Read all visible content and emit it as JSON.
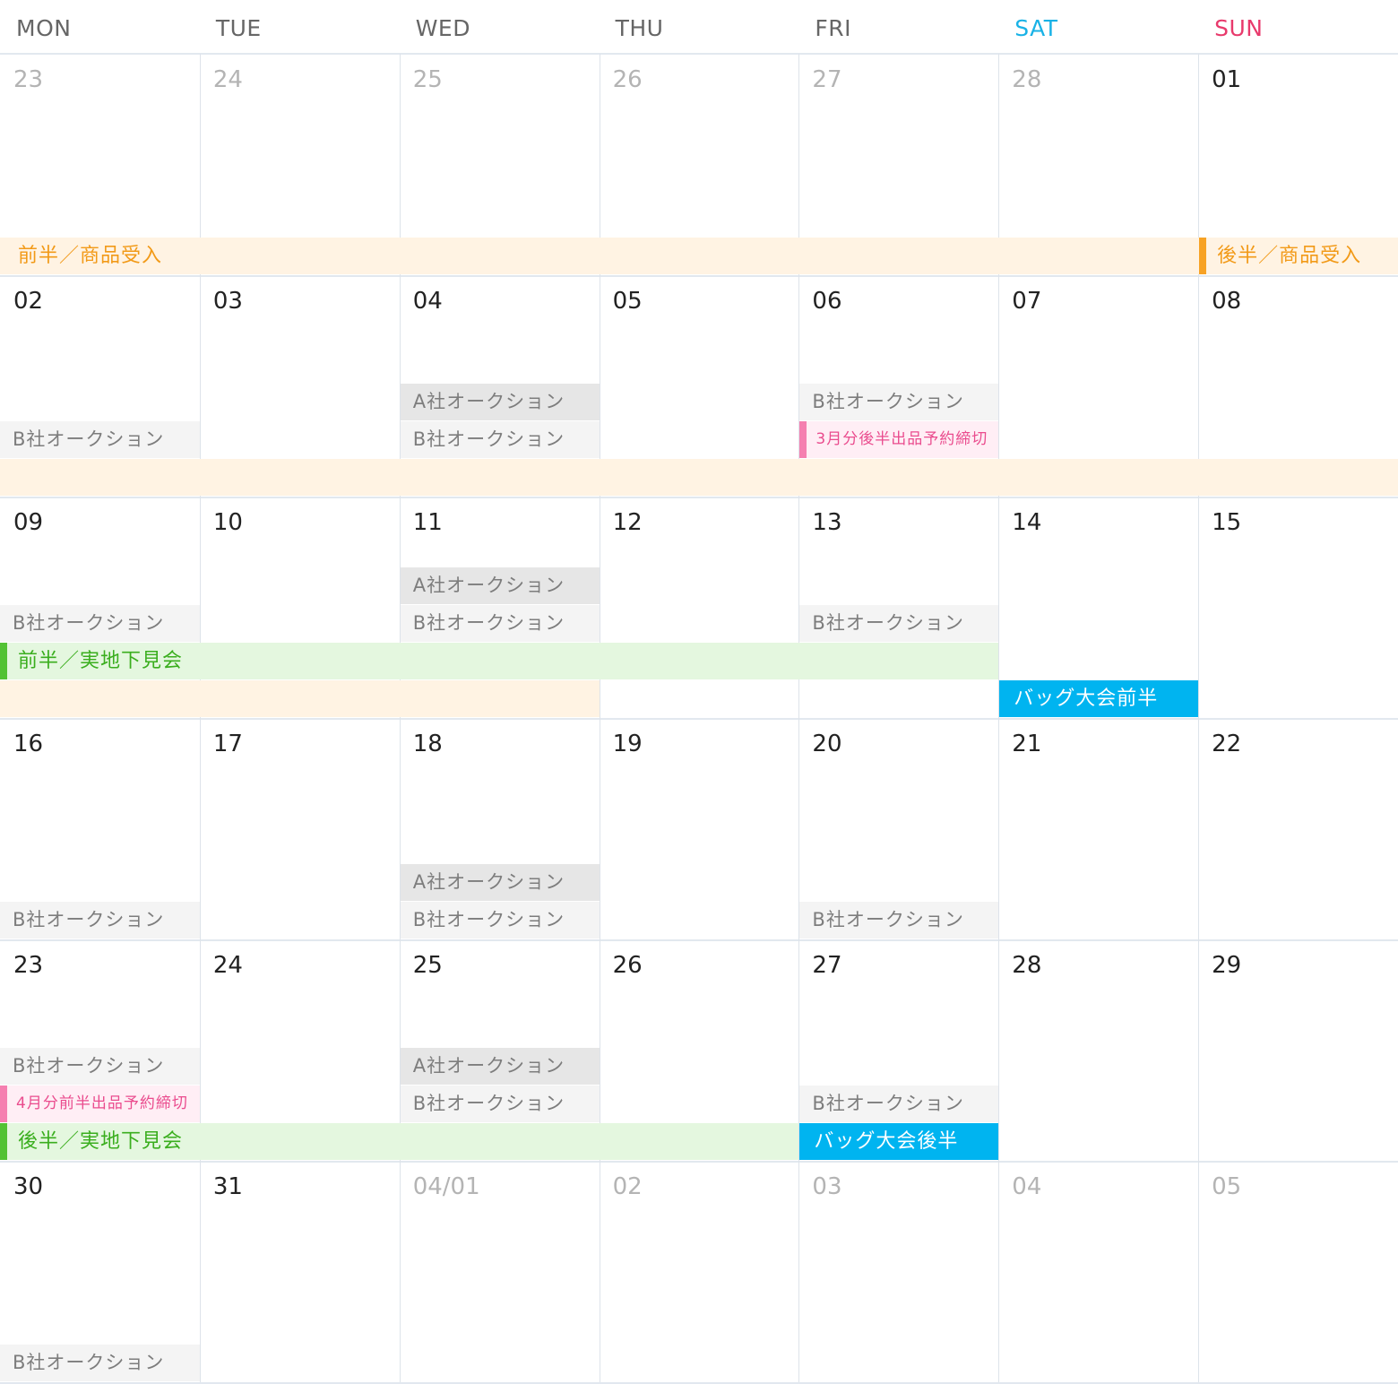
{
  "colors": {
    "sat": "#19b2e6",
    "sun": "#e83a6c",
    "orange_text": "#f29a18",
    "orange_bg": "#fff3e3",
    "orange_accent": "#f7a224",
    "green_text": "#3aae1e",
    "green_bg": "#e4f7df",
    "green_accent": "#52c234",
    "pink_text": "#ea4c8e",
    "pink_bg": "#ffeef5",
    "pink_accent": "#f57fb0",
    "gray_a_bg": "#e6e6e6",
    "gray_b_bg": "#f4f4f4",
    "gray_text": "#7d7d7d",
    "blue_bg": "#00b4f0",
    "blue_text": "#ffffff"
  },
  "weekdays": [
    "MON",
    "TUE",
    "WED",
    "THU",
    "FRI",
    "SAT",
    "SUN"
  ],
  "weeks": [
    {
      "days": [
        {
          "num": "23",
          "out": true
        },
        {
          "num": "24",
          "out": true
        },
        {
          "num": "25",
          "out": true
        },
        {
          "num": "26",
          "out": true
        },
        {
          "num": "27",
          "out": true
        },
        {
          "num": "28",
          "out": true
        },
        {
          "num": "01",
          "out": false
        }
      ]
    },
    {
      "days": [
        {
          "num": "02",
          "out": false
        },
        {
          "num": "03",
          "out": false
        },
        {
          "num": "04",
          "out": false
        },
        {
          "num": "05",
          "out": false
        },
        {
          "num": "06",
          "out": false
        },
        {
          "num": "07",
          "out": false
        },
        {
          "num": "08",
          "out": false
        }
      ]
    },
    {
      "days": [
        {
          "num": "09",
          "out": false
        },
        {
          "num": "10",
          "out": false
        },
        {
          "num": "11",
          "out": false
        },
        {
          "num": "12",
          "out": false
        },
        {
          "num": "13",
          "out": false
        },
        {
          "num": "14",
          "out": false
        },
        {
          "num": "15",
          "out": false
        }
      ]
    },
    {
      "days": [
        {
          "num": "16",
          "out": false
        },
        {
          "num": "17",
          "out": false
        },
        {
          "num": "18",
          "out": false
        },
        {
          "num": "19",
          "out": false
        },
        {
          "num": "20",
          "out": false
        },
        {
          "num": "21",
          "out": false
        },
        {
          "num": "22",
          "out": false
        }
      ]
    },
    {
      "days": [
        {
          "num": "23",
          "out": false
        },
        {
          "num": "24",
          "out": false
        },
        {
          "num": "25",
          "out": false
        },
        {
          "num": "26",
          "out": false
        },
        {
          "num": "27",
          "out": false
        },
        {
          "num": "28",
          "out": false
        },
        {
          "num": "29",
          "out": false
        }
      ]
    },
    {
      "days": [
        {
          "num": "30",
          "out": false
        },
        {
          "num": "31",
          "out": false
        },
        {
          "num": "04/01",
          "out": true
        },
        {
          "num": "02",
          "out": true
        },
        {
          "num": "03",
          "out": true
        },
        {
          "num": "04",
          "out": true
        },
        {
          "num": "05",
          "out": true
        }
      ]
    }
  ],
  "events": [
    {
      "week": 0,
      "slot": 0,
      "start": 0,
      "span": 7,
      "style": "orange",
      "label": ""
    },
    {
      "week": 0,
      "slot": 0,
      "start": 0,
      "span": 1,
      "style": "orange_label",
      "label": "前半／商品受入"
    },
    {
      "week": 0,
      "slot": 0,
      "start": 6,
      "span": 1,
      "style": "orange_accent",
      "label": "後半／商品受入"
    },
    {
      "week": 1,
      "slot": 2,
      "start": 2,
      "span": 1,
      "style": "gray_a",
      "label": "A社オークション"
    },
    {
      "week": 1,
      "slot": 2,
      "start": 4,
      "span": 1,
      "style": "gray_b",
      "label": "B社オークション"
    },
    {
      "week": 1,
      "slot": 1,
      "start": 0,
      "span": 1,
      "style": "gray_b",
      "label": "B社オークション"
    },
    {
      "week": 1,
      "slot": 1,
      "start": 2,
      "span": 1,
      "style": "gray_b",
      "label": "B社オークション"
    },
    {
      "week": 1,
      "slot": 1,
      "start": 4,
      "span": 1,
      "style": "pink",
      "label": "3月分後半出品予約締切"
    },
    {
      "week": 1,
      "slot": 0,
      "start": 0,
      "span": 7,
      "style": "orange",
      "label": ""
    },
    {
      "week": 2,
      "slot": 3,
      "start": 2,
      "span": 1,
      "style": "gray_a",
      "label": "A社オークション"
    },
    {
      "week": 2,
      "slot": 2,
      "start": 0,
      "span": 1,
      "style": "gray_b",
      "label": "B社オークション"
    },
    {
      "week": 2,
      "slot": 2,
      "start": 2,
      "span": 1,
      "style": "gray_b",
      "label": "B社オークション"
    },
    {
      "week": 2,
      "slot": 2,
      "start": 4,
      "span": 1,
      "style": "gray_b",
      "label": "B社オークション"
    },
    {
      "week": 2,
      "slot": 1,
      "start": 0,
      "span": 5,
      "style": "green",
      "label": "前半／実地下見会"
    },
    {
      "week": 2,
      "slot": 0,
      "start": 0,
      "span": 3,
      "style": "orange",
      "label": ""
    },
    {
      "week": 2,
      "slot": 0,
      "start": 5,
      "span": 1,
      "style": "blue",
      "label": "バッグ大会前半"
    },
    {
      "week": 3,
      "slot": 1,
      "start": 2,
      "span": 1,
      "style": "gray_a",
      "label": "A社オークション"
    },
    {
      "week": 3,
      "slot": 0,
      "start": 0,
      "span": 1,
      "style": "gray_b",
      "label": "B社オークション"
    },
    {
      "week": 3,
      "slot": 0,
      "start": 2,
      "span": 1,
      "style": "gray_b",
      "label": "B社オークション"
    },
    {
      "week": 3,
      "slot": 0,
      "start": 4,
      "span": 1,
      "style": "gray_b",
      "label": "B社オークション"
    },
    {
      "week": 4,
      "slot": 2,
      "start": 0,
      "span": 1,
      "style": "gray_b",
      "label": "B社オークション"
    },
    {
      "week": 4,
      "slot": 2,
      "start": 2,
      "span": 1,
      "style": "gray_a",
      "label": "A社オークション"
    },
    {
      "week": 4,
      "slot": 1,
      "start": 0,
      "span": 1,
      "style": "pink",
      "label": "4月分前半出品予約締切"
    },
    {
      "week": 4,
      "slot": 1,
      "start": 2,
      "span": 1,
      "style": "gray_b",
      "label": "B社オークション"
    },
    {
      "week": 4,
      "slot": 1,
      "start": 4,
      "span": 1,
      "style": "gray_b",
      "label": "B社オークション"
    },
    {
      "week": 4,
      "slot": 0,
      "start": 0,
      "span": 4,
      "style": "green",
      "label": "後半／実地下見会"
    },
    {
      "week": 4,
      "slot": 0,
      "start": 4,
      "span": 1,
      "style": "blue",
      "label": "バッグ大会後半"
    },
    {
      "week": 5,
      "slot": 0,
      "start": 0,
      "span": 1,
      "style": "gray_b",
      "label": "B社オークション"
    }
  ]
}
